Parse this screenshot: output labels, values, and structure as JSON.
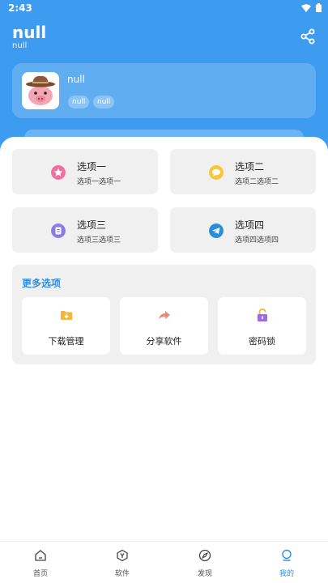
{
  "status_bar": {
    "time": "2:43"
  },
  "header": {
    "title": "null",
    "subtitle": "null"
  },
  "profile": {
    "name": "null",
    "tags": [
      "null",
      "null"
    ]
  },
  "options": [
    {
      "title": "选项一",
      "subtitle": "选项一选项一",
      "icon": "star-icon",
      "color": "#f06ea0"
    },
    {
      "title": "选项二",
      "subtitle": "选项二选项二",
      "icon": "chat-bubble-icon",
      "color": "#f5c83a"
    },
    {
      "title": "选项三",
      "subtitle": "选项三选项三",
      "icon": "document-icon",
      "color": "#8b7ae8"
    },
    {
      "title": "选项四",
      "subtitle": "选项四选项四",
      "icon": "telegram-icon",
      "color": "#2a8fd8"
    }
  ],
  "more": {
    "title": "更多选项",
    "items": [
      {
        "label": "下载管理",
        "icon": "folder-download-icon",
        "color": "#f5b43a"
      },
      {
        "label": "分享软件",
        "icon": "share-arrow-icon",
        "color": "#e98a7a"
      },
      {
        "label": "密码锁",
        "icon": "lock-icon",
        "color": "#9b6ce0"
      }
    ]
  },
  "nav": [
    {
      "label": "首页",
      "icon": "home-icon"
    },
    {
      "label": "软件",
      "icon": "software-icon"
    },
    {
      "label": "发现",
      "icon": "compass-icon"
    },
    {
      "label": "我的",
      "icon": "profile-icon",
      "active": true
    }
  ],
  "colors": {
    "primary": "#3d9bf0",
    "accent": "#2f8ee8",
    "card_bg": "#f0f0f0"
  }
}
